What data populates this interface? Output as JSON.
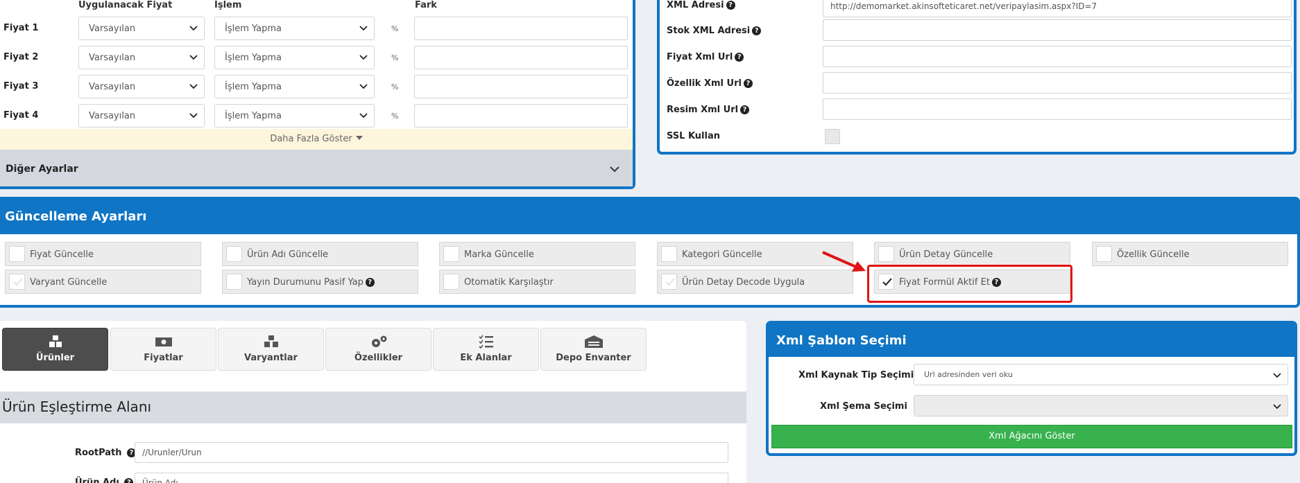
{
  "price": {
    "col_price": "Uygulanacak Fiyat",
    "col_operation": "İşlem",
    "col_diff": "Fark",
    "percent": "%",
    "rows": [
      {
        "label": "Fiyat 1",
        "price": "Varsayılan",
        "operation": "İşlem Yapma",
        "diff": ""
      },
      {
        "label": "Fiyat 2",
        "price": "Varsayılan",
        "operation": "İşlem Yapma",
        "diff": ""
      },
      {
        "label": "Fiyat 3",
        "price": "Varsayılan",
        "operation": "İşlem Yapma",
        "diff": ""
      },
      {
        "label": "Fiyat 4",
        "price": "Varsayılan",
        "operation": "İşlem Yapma",
        "diff": ""
      }
    ],
    "show_more": "Daha Fazla Göster",
    "other_settings": "Diğer Ayarlar"
  },
  "xml": {
    "xml_address_label": "XML Adresi",
    "xml_address_value": "http://demomarket.akinsofteticaret.net/veripaylasim.aspx?ID=7",
    "stock_label": "Stok XML Adresi",
    "price_url_label": "Fiyat Xml Url",
    "feature_url_label": "Özellik Xml Url",
    "image_url_label": "Resim Xml Url",
    "ssl_label": "SSL Kullan"
  },
  "update": {
    "title": "Güncelleme Ayarları",
    "row1": [
      {
        "label": "Fiyat Güncelle",
        "checked": false
      },
      {
        "label": "Ürün Adı Güncelle",
        "checked": false
      },
      {
        "label": "Marka Güncelle",
        "checked": false
      },
      {
        "label": "Kategori Güncelle",
        "checked": false
      },
      {
        "label": "Ürün Detay Güncelle",
        "checked": false
      },
      {
        "label": "Özellik Güncelle",
        "checked": false
      }
    ],
    "row2": [
      {
        "label": "Varyant Güncelle",
        "checked": false
      },
      {
        "label": "Yayın Durumunu Pasif Yap",
        "checked": false
      },
      {
        "label": "Otomatik Karşılaştır",
        "checked": false
      },
      {
        "label": "Ürün Detay Decode Uygula",
        "checked": false
      },
      {
        "label": "Fiyat Formül Aktif Et",
        "checked": true
      }
    ]
  },
  "tabs": [
    {
      "label": "Ürünler",
      "icon": "boxes-icon",
      "active": true
    },
    {
      "label": "Fiyatlar",
      "icon": "money-icon",
      "active": false
    },
    {
      "label": "Varyantlar",
      "icon": "cubes-icon",
      "active": false
    },
    {
      "label": "Özellikler",
      "icon": "cogs-icon",
      "active": false
    },
    {
      "label": "Ek Alanlar",
      "icon": "list-check-icon",
      "active": false
    },
    {
      "label": "Depo Envanter",
      "icon": "warehouse-icon",
      "active": false
    }
  ],
  "mapping": {
    "title": "Ürün Eşleştirme Alanı",
    "root_label": "RootPath",
    "root_value": "//Urunler/Urun",
    "name_label": "Ürün Adı",
    "name_value": "Ürün Adı"
  },
  "sablon": {
    "title": "Xml Şablon Seçimi",
    "source_label": "Xml Kaynak Tip Seçimi",
    "source_value": "Url adresinden veri oku",
    "schema_label": "Xml Şema Seçimi",
    "schema_value": "",
    "tree_button": "Xml Ağacını Göster"
  },
  "colors": {
    "accent": "#0f75c4",
    "success": "#37b24d",
    "highlight": "#e01414",
    "active_tab": "#4d4d4d"
  }
}
